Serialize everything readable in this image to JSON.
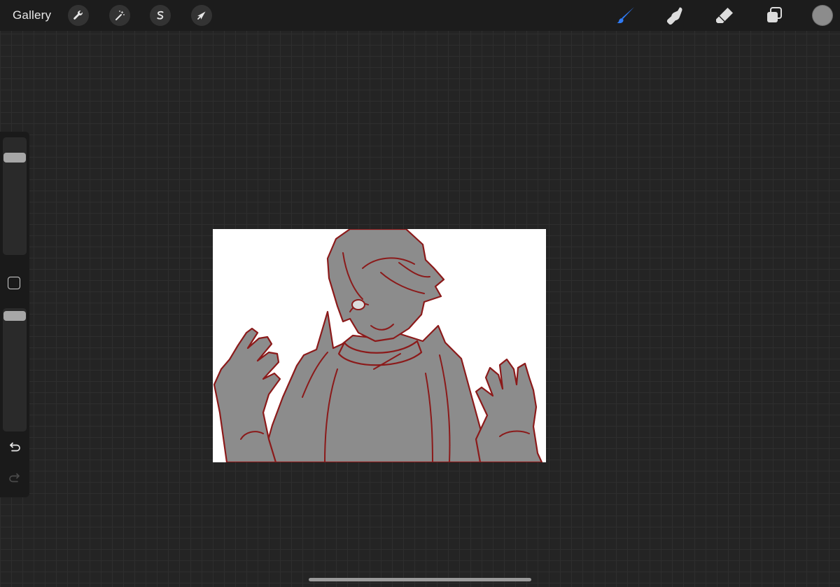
{
  "topbar": {
    "gallery_label": "Gallery",
    "left_tools": [
      {
        "name": "actions",
        "icon": "wrench-icon"
      },
      {
        "name": "adjustments",
        "icon": "magic-wand-icon"
      },
      {
        "name": "selection",
        "icon": "selection-s-icon"
      },
      {
        "name": "transform",
        "icon": "arrow-cursor-icon"
      }
    ],
    "right_tools": [
      {
        "name": "brush",
        "icon": "brush-icon",
        "active": true
      },
      {
        "name": "smudge",
        "icon": "smudge-finger-icon",
        "active": false
      },
      {
        "name": "eraser",
        "icon": "eraser-icon",
        "active": false
      },
      {
        "name": "layers",
        "icon": "layers-icon",
        "active": false
      }
    ],
    "current_color": "#8c8c8c"
  },
  "sidebar": {
    "brush_size_level": 0.88,
    "opacity_level": 1.0,
    "modify_icon": "square-icon",
    "undo_icon": "undo-arrow-icon",
    "redo_icon": "redo-arrow-icon",
    "redo_enabled": false
  },
  "canvas": {
    "background": "#ffffff",
    "fill_color": "#8c8c8c",
    "line_color": "#8b1a1a"
  },
  "colors": {
    "accent": "#2f7bf5",
    "bar": "#1c1c1c",
    "workspace": "#242424"
  }
}
